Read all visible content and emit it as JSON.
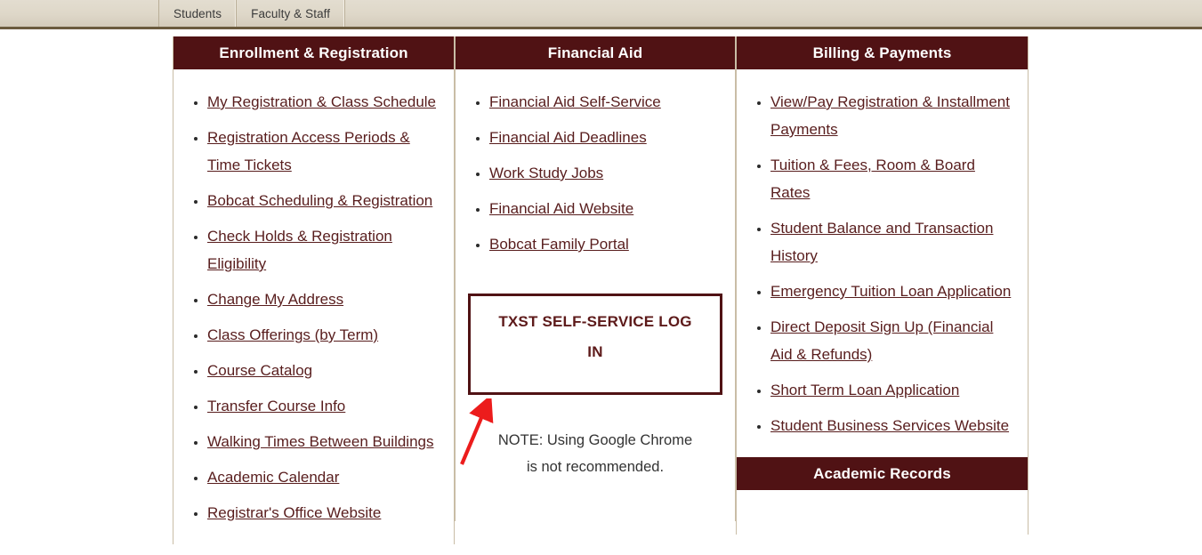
{
  "topnav": {
    "items": [
      {
        "label": "Students"
      },
      {
        "label": "Faculty & Staff"
      }
    ]
  },
  "columns": {
    "enrollment": {
      "heading": "Enrollment & Registration",
      "links": [
        "My Registration & Class Schedule",
        "Registration Access Periods & Time Tickets",
        "Bobcat Scheduling & Registration",
        "Check Holds & Registration Eligibility",
        "Change My Address",
        "Class Offerings (by Term)",
        "Course Catalog",
        "Transfer Course Info",
        "Walking Times Between Buildings",
        "Academic Calendar",
        "Registrar's Office Website"
      ]
    },
    "financial_aid": {
      "heading": "Financial Aid",
      "links": [
        "Financial Aid Self-Service",
        "Financial Aid Deadlines",
        "Work Study Jobs",
        "Financial Aid Website",
        "Bobcat Family Portal"
      ],
      "login_button": "TXST SELF-SERVICE LOG IN",
      "note_lines": [
        "NOTE:  Using Google Chrome",
        "is not recommended."
      ]
    },
    "billing": {
      "heading": "Billing & Payments",
      "links": [
        "View/Pay Registration & Installment Payments",
        "Tuition & Fees, Room & Board Rates",
        "Student Balance and Transaction History",
        "Emergency Tuition Loan Application",
        "Direct Deposit Sign Up (Financial Aid & Refunds)",
        "Short Term Loan Application",
        "Student Business Services Website"
      ]
    },
    "academic_records": {
      "heading": "Academic Records"
    }
  },
  "annotation": {
    "arrow_color": "#ec1c1c",
    "arrow_target": "TXST SELF-SERVICE LOG IN"
  },
  "theme": {
    "maroon": "#501214",
    "link_maroon": "#581d1d",
    "nav_tan": "#ded7c8",
    "border_tan": "#c9bda6",
    "nav_border_brown": "#6b5b3e"
  }
}
